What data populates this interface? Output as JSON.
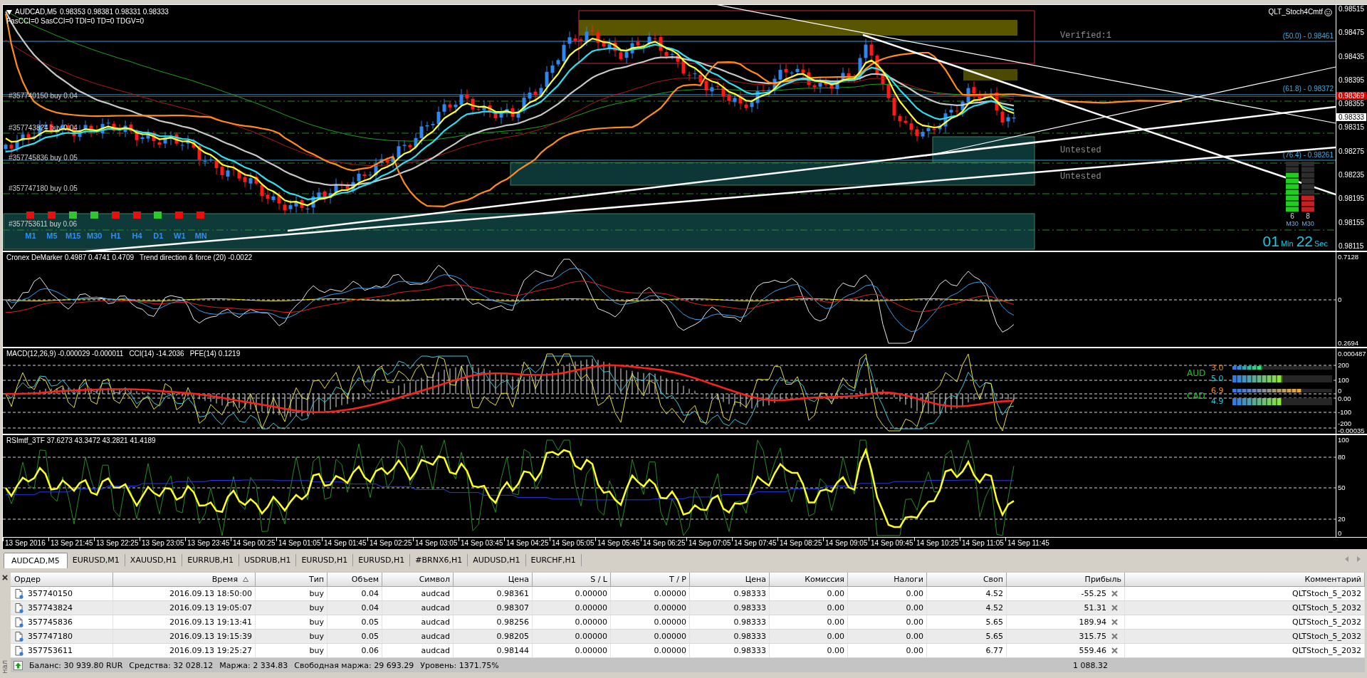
{
  "chart": {
    "header": {
      "symbol": "AUDCAD,M5",
      "quotes": "0.98353 0.98381 0.98331 0.98333",
      "indicators": "FasCCI=0 SasCCI=0 TDI=0 TD=0 TDGV=0"
    },
    "expert": "QLT_Stoch4Cmtf",
    "zone_labels": [
      "Verified:1",
      "Untested",
      "Untested"
    ],
    "fib_levels": [
      "(50.0) - 0.98461",
      "(61.8) - 0.98372",
      "(76.4) - 0.98261"
    ],
    "orders": [
      "#357740150 buy 0.04",
      "#357743824 buy 0.04",
      "#357745836 buy 0.05",
      "#357747180 buy 0.05",
      "#357753611 buy 0.06"
    ],
    "timeframes": [
      {
        "label": "M1",
        "color": "#e8100c"
      },
      {
        "label": "M5",
        "color": "#e8100c"
      },
      {
        "label": "M15",
        "color": "#2ec82e"
      },
      {
        "label": "M30",
        "color": "#2ec82e"
      },
      {
        "label": "H1",
        "color": "#e8100c"
      },
      {
        "label": "H4",
        "color": "#e8100c"
      },
      {
        "label": "D1",
        "color": "#2ec82e"
      },
      {
        "label": "W1",
        "color": "#e8100c"
      },
      {
        "label": "MN",
        "color": "#e8100c"
      }
    ],
    "meters": [
      {
        "kind": "bull",
        "level": 0.78,
        "value": "6",
        "label": "M30"
      },
      {
        "kind": "bear",
        "level": 0.33,
        "value": "8",
        "label": "M30"
      }
    ],
    "timer": {
      "minutes": "01",
      "minutes_unit": "Min",
      "seconds": "22",
      "seconds_unit": "Sec"
    },
    "price_axis": [
      "0.98515",
      "0.98475",
      "0.98435",
      "0.98395",
      "0.98355",
      "0.98315",
      "0.98275",
      "0.98235",
      "0.98195",
      "0.98155",
      "0.98115"
    ],
    "price_tags": [
      {
        "kind": "ask",
        "text": "0.98369"
      },
      {
        "kind": "bid",
        "text": "0.98333"
      }
    ]
  },
  "indicator_panels": [
    {
      "kind": "demarker",
      "titles": [
        "Cronex DeMarker 0.4987 0.4741 0.4709",
        "Trend direction & force (20) -0.0022"
      ],
      "axis": [
        "0.7128",
        "0",
        "0.2694"
      ]
    },
    {
      "kind": "macd",
      "titles": [
        "MACD(12,26,9) -0.000029 -0.000011",
        "CCI(14) -14.2036",
        "PFE(14) 0.1219"
      ],
      "axis": [
        "0.000487",
        "200",
        "100",
        "0",
        "0.00",
        "-100",
        "-200",
        "-0.00035"
      ],
      "strength": [
        {
          "currency": "AUD",
          "readings": [
            {
              "kind": "small",
              "value": "3.0",
              "level": 0.3
            },
            {
              "kind": "large",
              "value": "5.0",
              "level": 0.5
            }
          ]
        },
        {
          "currency": "CAD",
          "readings": [
            {
              "kind": "small",
              "value": "6.9",
              "level": 0.69
            },
            {
              "kind": "large",
              "value": "4.9",
              "level": 0.49
            }
          ]
        }
      ]
    },
    {
      "kind": "rsi",
      "titles": [
        "RSImtf_3TF 37.6273 43.3472 43.2821 41.4189"
      ],
      "axis": [
        "100",
        "80",
        "50",
        "20",
        "0"
      ]
    }
  ],
  "time_axis": [
    "13 Sep 2016",
    "13 Sep 21:45",
    "13 Sep 22:25",
    "13 Sep 23:05",
    "13 Sep 23:45",
    "14 Sep 00:25",
    "14 Sep 01:05",
    "14 Sep 01:45",
    "14 Sep 02:25",
    "14 Sep 03:05",
    "14 Sep 03:45",
    "14 Sep 04:25",
    "14 Sep 05:05",
    "14 Sep 05:45",
    "14 Sep 06:25",
    "14 Sep 07:05",
    "14 Sep 07:45",
    "14 Sep 08:25",
    "14 Sep 09:05",
    "14 Sep 09:45",
    "14 Sep 10:25",
    "14 Sep 11:05",
    "14 Sep 11:45"
  ],
  "chart_tabs": [
    {
      "label": "AUDCAD,M5",
      "selected": true
    },
    {
      "label": "EURUSD,M1",
      "selected": false
    },
    {
      "label": "XAUUSD,H1",
      "selected": false
    },
    {
      "label": "EURRUB,H1",
      "selected": false
    },
    {
      "label": "USDRUB,H1",
      "selected": false
    },
    {
      "label": "EURUSD,H1",
      "selected": false
    },
    {
      "label": "EURUSD,H1",
      "selected": false
    },
    {
      "label": "#BRNX6,H1",
      "selected": false
    },
    {
      "label": "AUDUSD,H1",
      "selected": false
    },
    {
      "label": "EURCHF,H1",
      "selected": false
    }
  ],
  "terminal": {
    "side_label": "нал",
    "columns": [
      {
        "label": "Ордер",
        "sorted": false
      },
      {
        "label": "Время",
        "sorted": true
      },
      {
        "label": "Тип",
        "sorted": false
      },
      {
        "label": "Объем",
        "sorted": false
      },
      {
        "label": "Символ",
        "sorted": false
      },
      {
        "label": "Цена",
        "sorted": false
      },
      {
        "label": "S / L",
        "sorted": false
      },
      {
        "label": "T / P",
        "sorted": false
      },
      {
        "label": "Цена",
        "sorted": false
      },
      {
        "label": "Комиссия",
        "sorted": false
      },
      {
        "label": "Налоги",
        "sorted": false
      },
      {
        "label": "Своп",
        "sorted": false
      },
      {
        "label": "Прибыль",
        "sorted": false
      },
      {
        "label": "Комментарий",
        "sorted": false
      }
    ],
    "rows": [
      [
        "357740150",
        "2016.09.13 18:50:00",
        "buy",
        "0.04",
        "audcad",
        "0.98361",
        "0.00000",
        "0.00000",
        "0.98333",
        "0.00",
        "0.00",
        "4.52",
        "-55.25",
        "QLTStoch_5_2032"
      ],
      [
        "357743824",
        "2016.09.13 19:05:07",
        "buy",
        "0.04",
        "audcad",
        "0.98307",
        "0.00000",
        "0.00000",
        "0.98333",
        "0.00",
        "0.00",
        "4.52",
        "51.31",
        "QLTStoch_5_2032"
      ],
      [
        "357745836",
        "2016.09.13 19:13:41",
        "buy",
        "0.05",
        "audcad",
        "0.98256",
        "0.00000",
        "0.00000",
        "0.98333",
        "0.00",
        "0.00",
        "5.65",
        "189.94",
        "QLTStoch_5_2032"
      ],
      [
        "357747180",
        "2016.09.13 19:15:39",
        "buy",
        "0.05",
        "audcad",
        "0.98205",
        "0.00000",
        "0.00000",
        "0.98333",
        "0.00",
        "0.00",
        "5.65",
        "315.75",
        "QLTStoch_5_2032"
      ],
      [
        "357753611",
        "2016.09.13 19:25:27",
        "buy",
        "0.06",
        "audcad",
        "0.98144",
        "0.00000",
        "0.00000",
        "0.98333",
        "0.00",
        "0.00",
        "6.77",
        "559.46",
        "QLTStoch_5_2032"
      ]
    ],
    "summary": [
      "Баланс: 30 939.80 RUR",
      "Средства: 32 028.12",
      "Маржа: 2 334.83",
      "Свободная маржа: 29 693.29",
      "Уровень: 1371.75%"
    ],
    "total_profit": "1 088.32"
  }
}
